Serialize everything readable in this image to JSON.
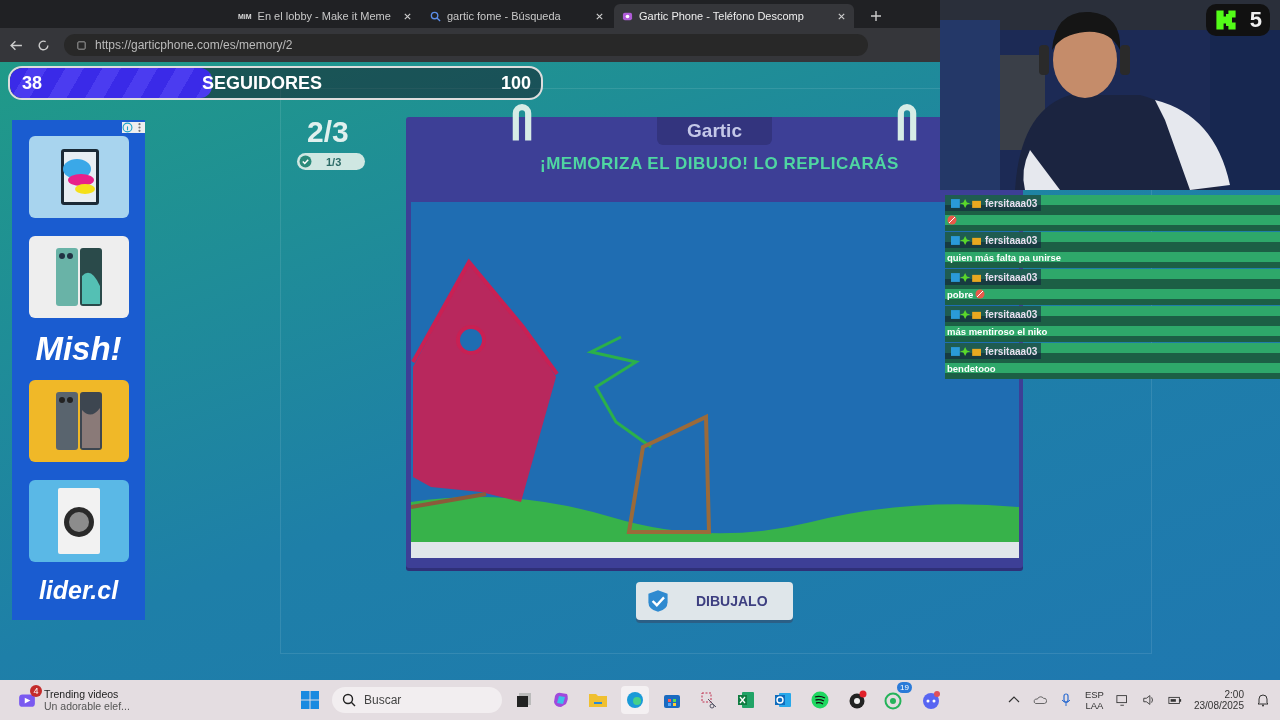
{
  "browser": {
    "tabs": [
      {
        "title": "En el lobby - Make it Meme",
        "favicon": "MiM",
        "selected": false
      },
      {
        "title": "gartic fome - Búsqueda",
        "selected": false
      },
      {
        "title": "Gartic Phone - Teléfono Descomp",
        "selected": true
      }
    ],
    "address": "https://garticphone.com/es/memory/2"
  },
  "followers": {
    "count": "38",
    "label": "SEGUIDORES",
    "goal": "100",
    "level": 0.38
  },
  "ad": {
    "slogan": "Mish!",
    "brand": "lider.cl"
  },
  "game": {
    "round": "2/3",
    "progress": "1/3",
    "logo": "Gartic",
    "title": "¡MEMORIZA EL DIBUJO! LO REPLICARÁS",
    "button": "DIBUJALO"
  },
  "stream": {
    "viewers": "5"
  },
  "chat": [
    {
      "user": "fersitaaa03",
      "emoji": true
    },
    {
      "user": "fersitaaa03",
      "text": "quien más falta pa unirse",
      "emoji": false
    },
    {
      "user": "fersitaaa03",
      "text": "pobre",
      "emoji": true
    },
    {
      "user": "fersitaaa03",
      "text": "más mentiroso el niko",
      "emoji": false
    },
    {
      "user": "fersitaaa03",
      "text": "bendetooo",
      "emoji": false
    }
  ],
  "taskbar": {
    "widget_badge": "4",
    "widget_title": "Trending videos",
    "widget_subtitle": "Un adorable elef...",
    "search_placeholder": "Buscar",
    "whatsapp_badge": "19",
    "language": "ESP",
    "layout": "LAA",
    "time": "2:00",
    "date": "23/08/2025"
  }
}
